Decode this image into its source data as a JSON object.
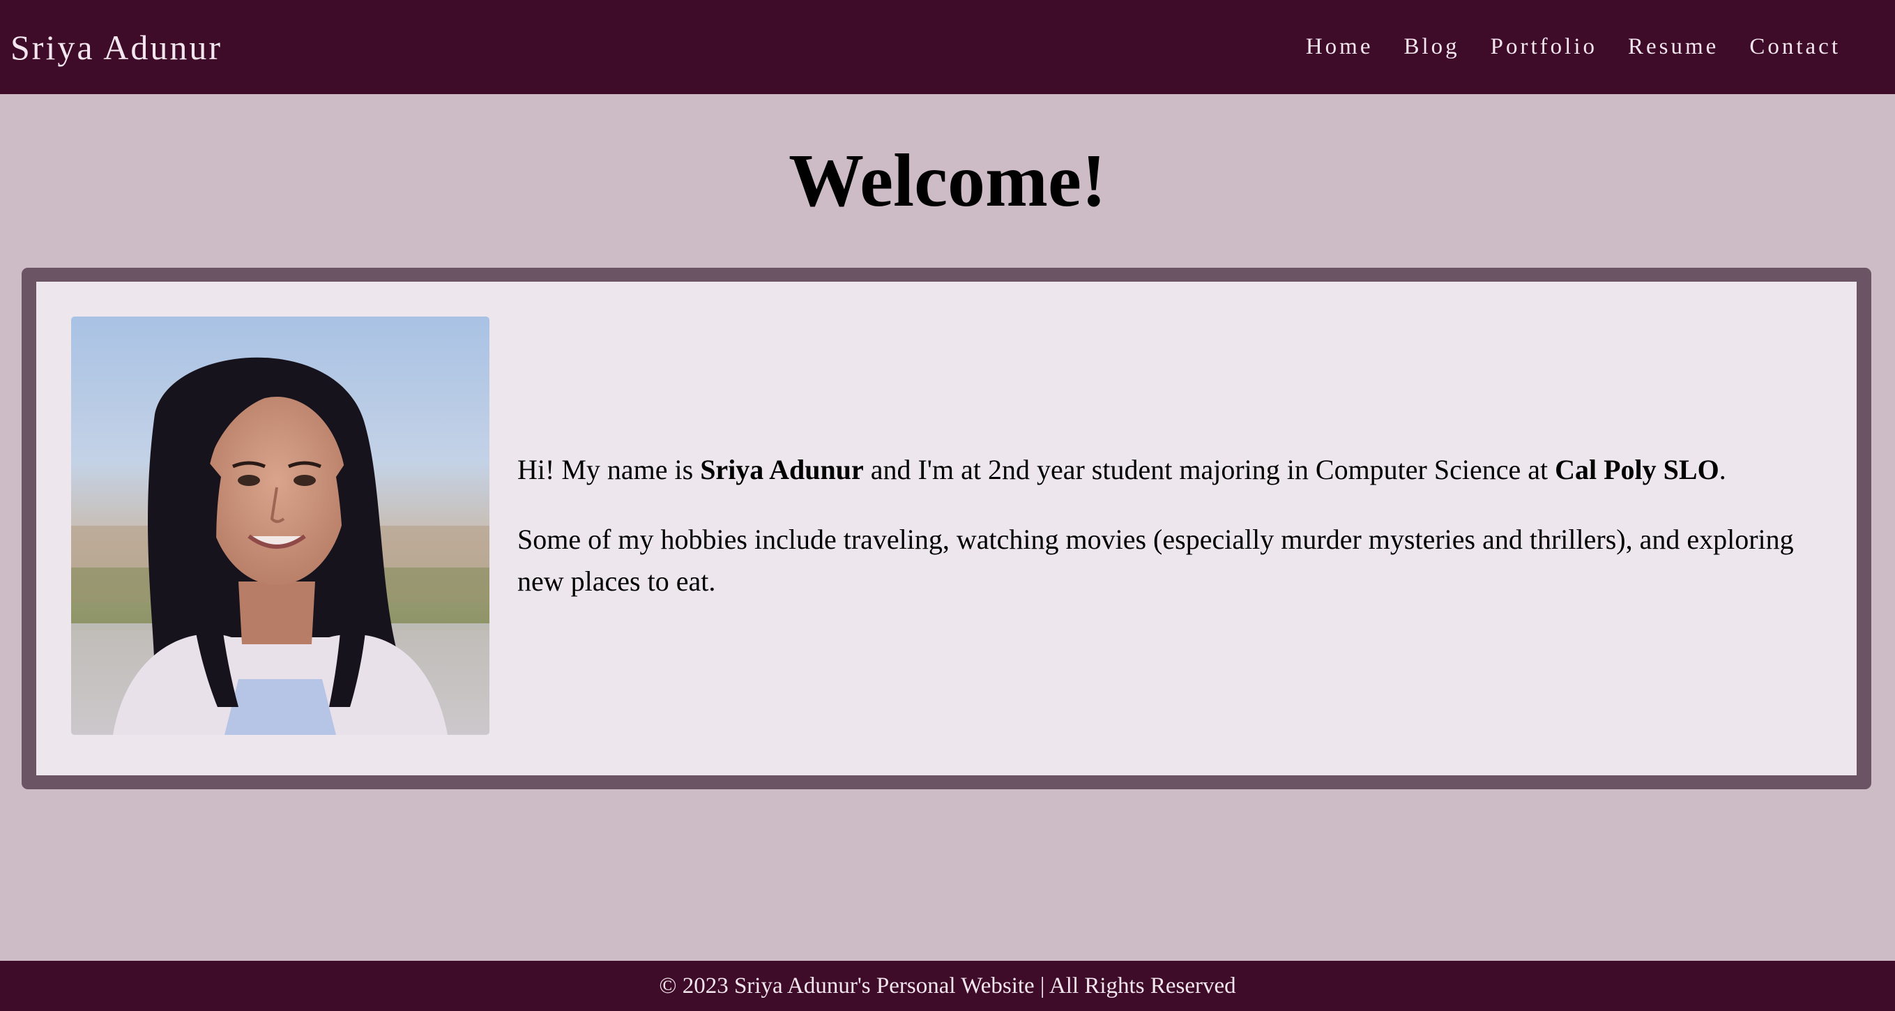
{
  "header": {
    "site_title": "Sriya Adunur",
    "nav": [
      {
        "label": "Home"
      },
      {
        "label": "Blog"
      },
      {
        "label": "Portfolio"
      },
      {
        "label": "Resume"
      },
      {
        "label": "Contact"
      }
    ]
  },
  "main": {
    "heading": "Welcome!",
    "intro": {
      "p1_prefix": "Hi! My name is ",
      "p1_name": "Sriya Adunur",
      "p1_middle": " and I'm at 2nd year student majoring in Computer Science at ",
      "p1_school": "Cal Poly SLO",
      "p1_suffix": ".",
      "p2": "Some of my hobbies include traveling, watching movies (especially murder mysteries and thrillers), and exploring new places to eat."
    }
  },
  "footer": {
    "text": "© 2023 Sriya Adunur's Personal Website | All Rights Reserved"
  },
  "colors": {
    "header_bg": "#3e0b29",
    "page_bg": "#cdbcc6",
    "card_frame": "#6b5564",
    "card_bg": "#ede7ed",
    "header_text": "#f3e6ee"
  }
}
